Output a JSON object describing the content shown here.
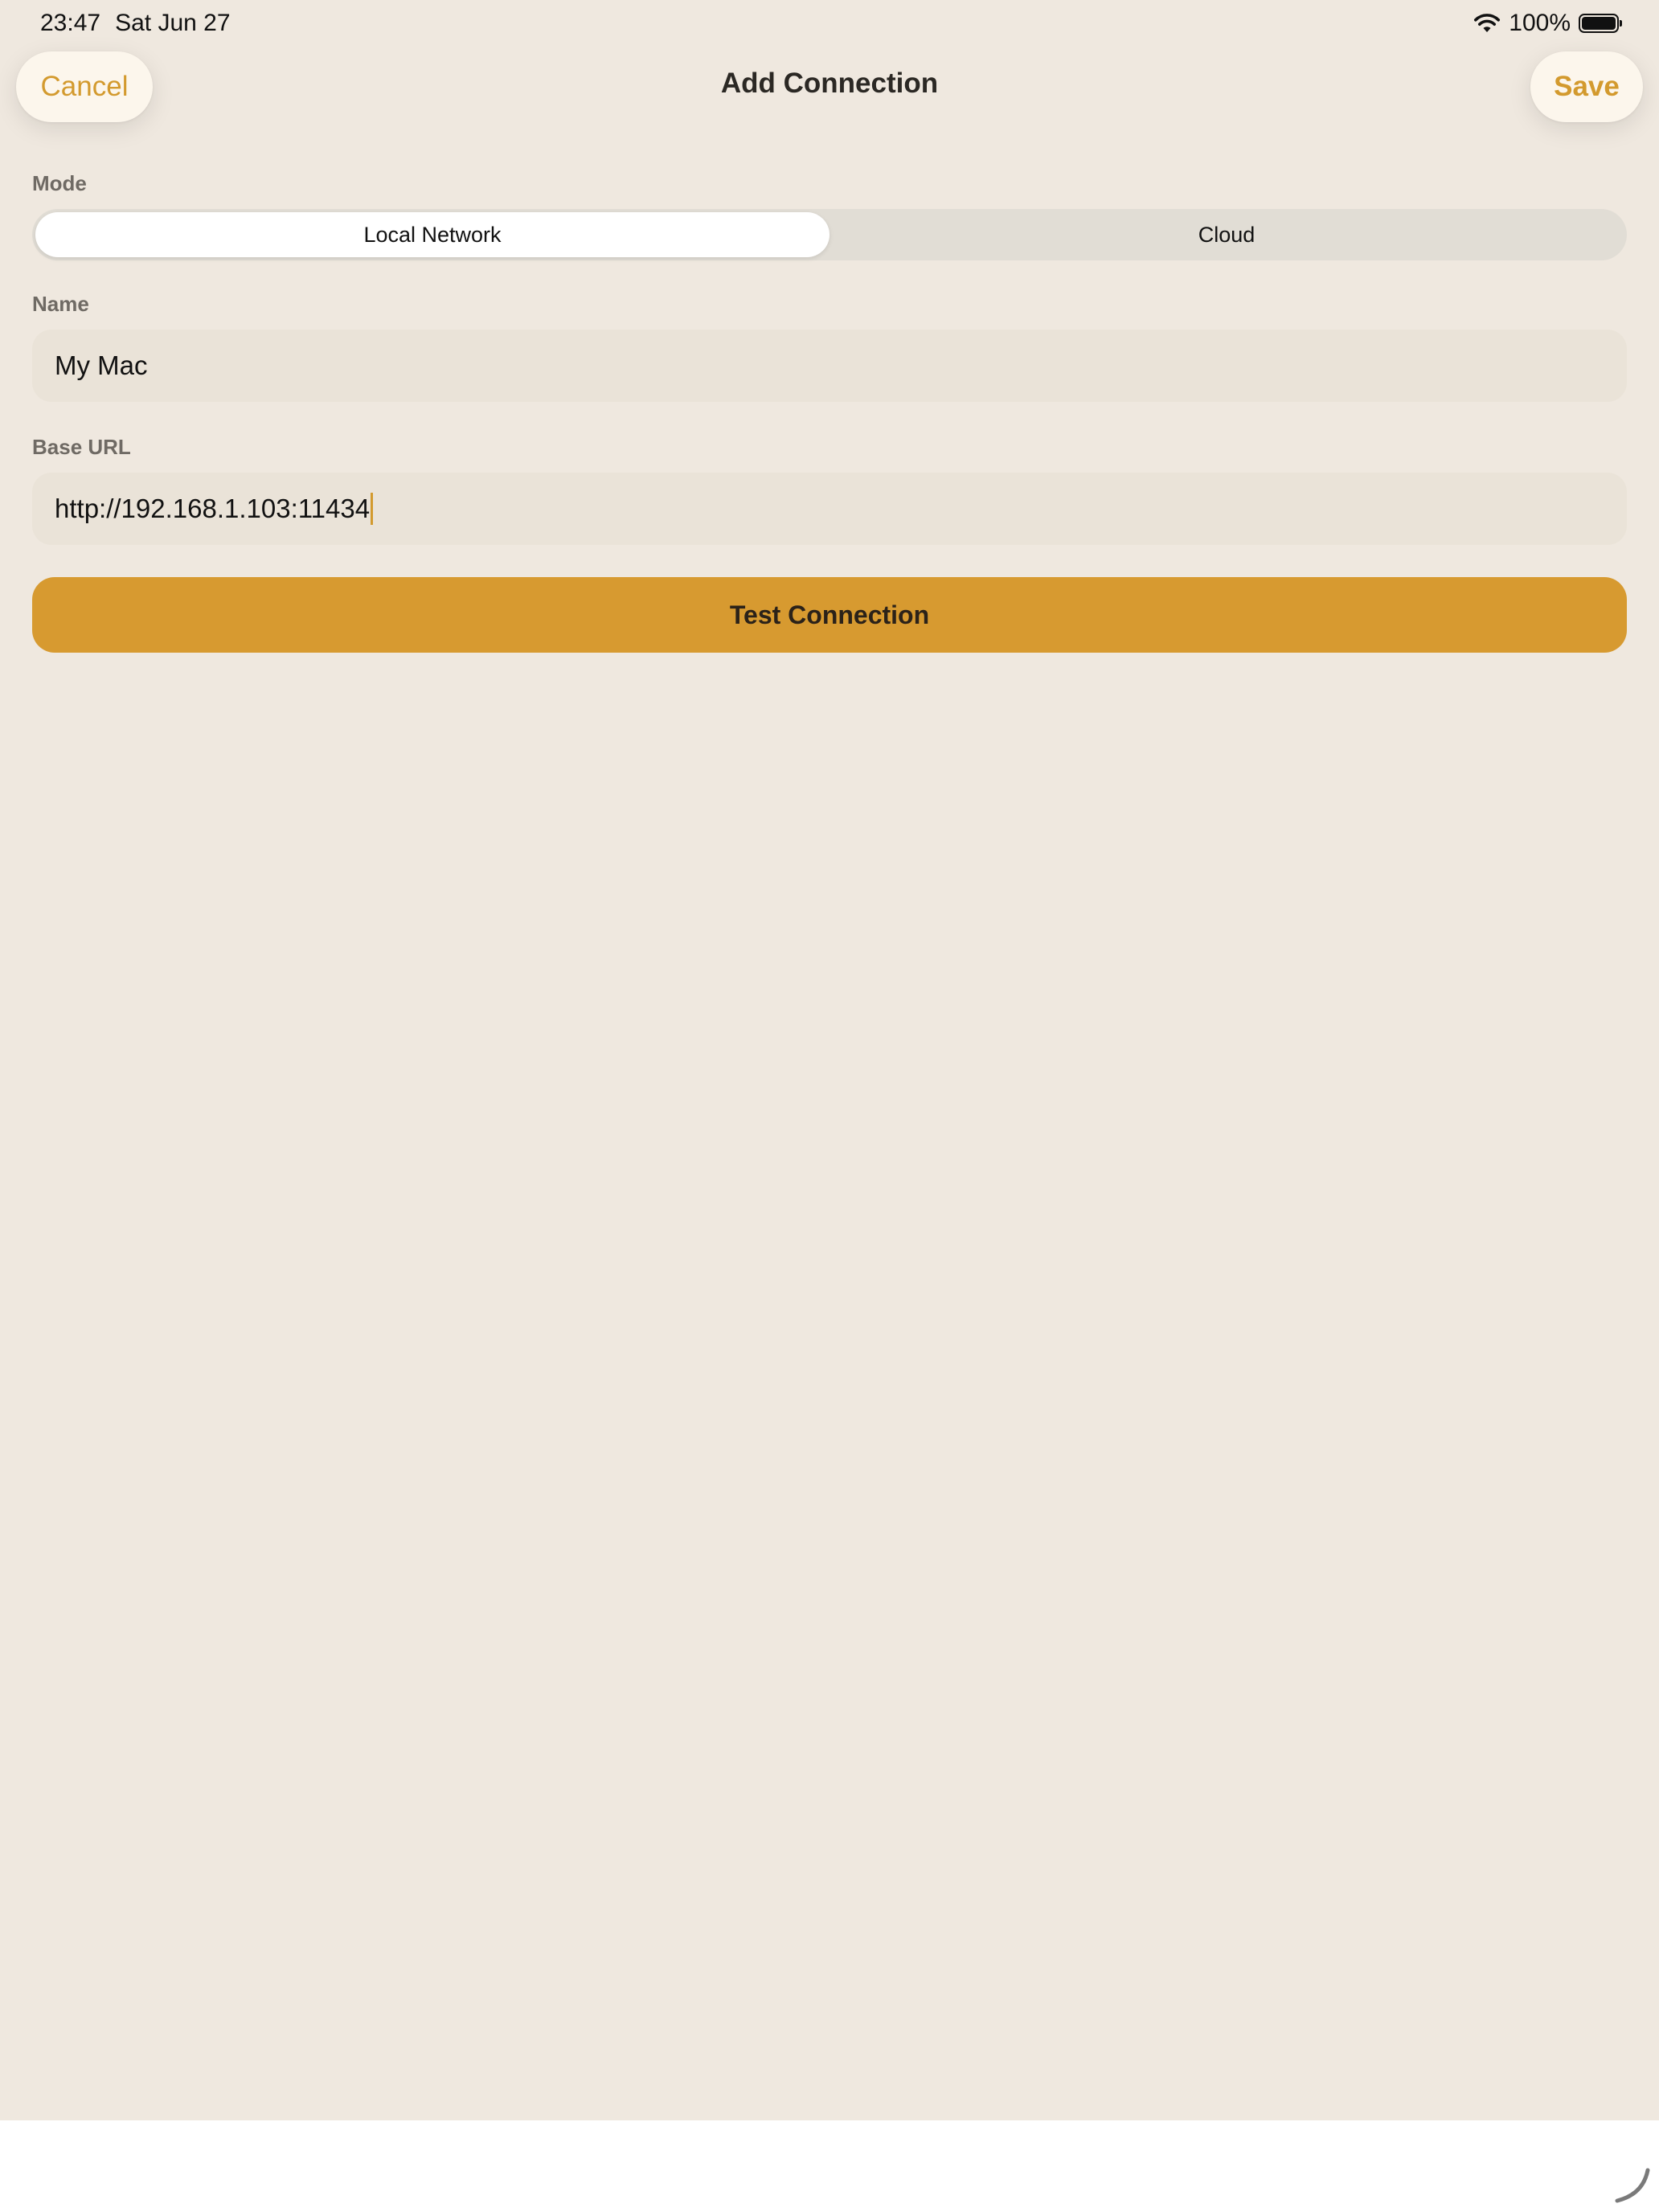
{
  "status_bar": {
    "time": "23:47",
    "date": "Sat Jun 27",
    "battery_text": "100%",
    "icons": [
      "wifi-icon",
      "battery-icon"
    ]
  },
  "nav": {
    "cancel_label": "Cancel",
    "title": "Add Connection",
    "save_label": "Save"
  },
  "form": {
    "mode_label": "Mode",
    "mode_options": [
      "Local Network",
      "Cloud"
    ],
    "mode_selected": "Local Network",
    "name_label": "Name",
    "name_value": "My Mac",
    "url_label": "Base URL",
    "url_value": "http://192.168.1.103:11434",
    "test_button_label": "Test Connection"
  },
  "colors": {
    "background": "#EFE8DF",
    "accent": "#D79A30",
    "accent_text": "#D39A2E",
    "field_background": "#EAE3D8"
  }
}
